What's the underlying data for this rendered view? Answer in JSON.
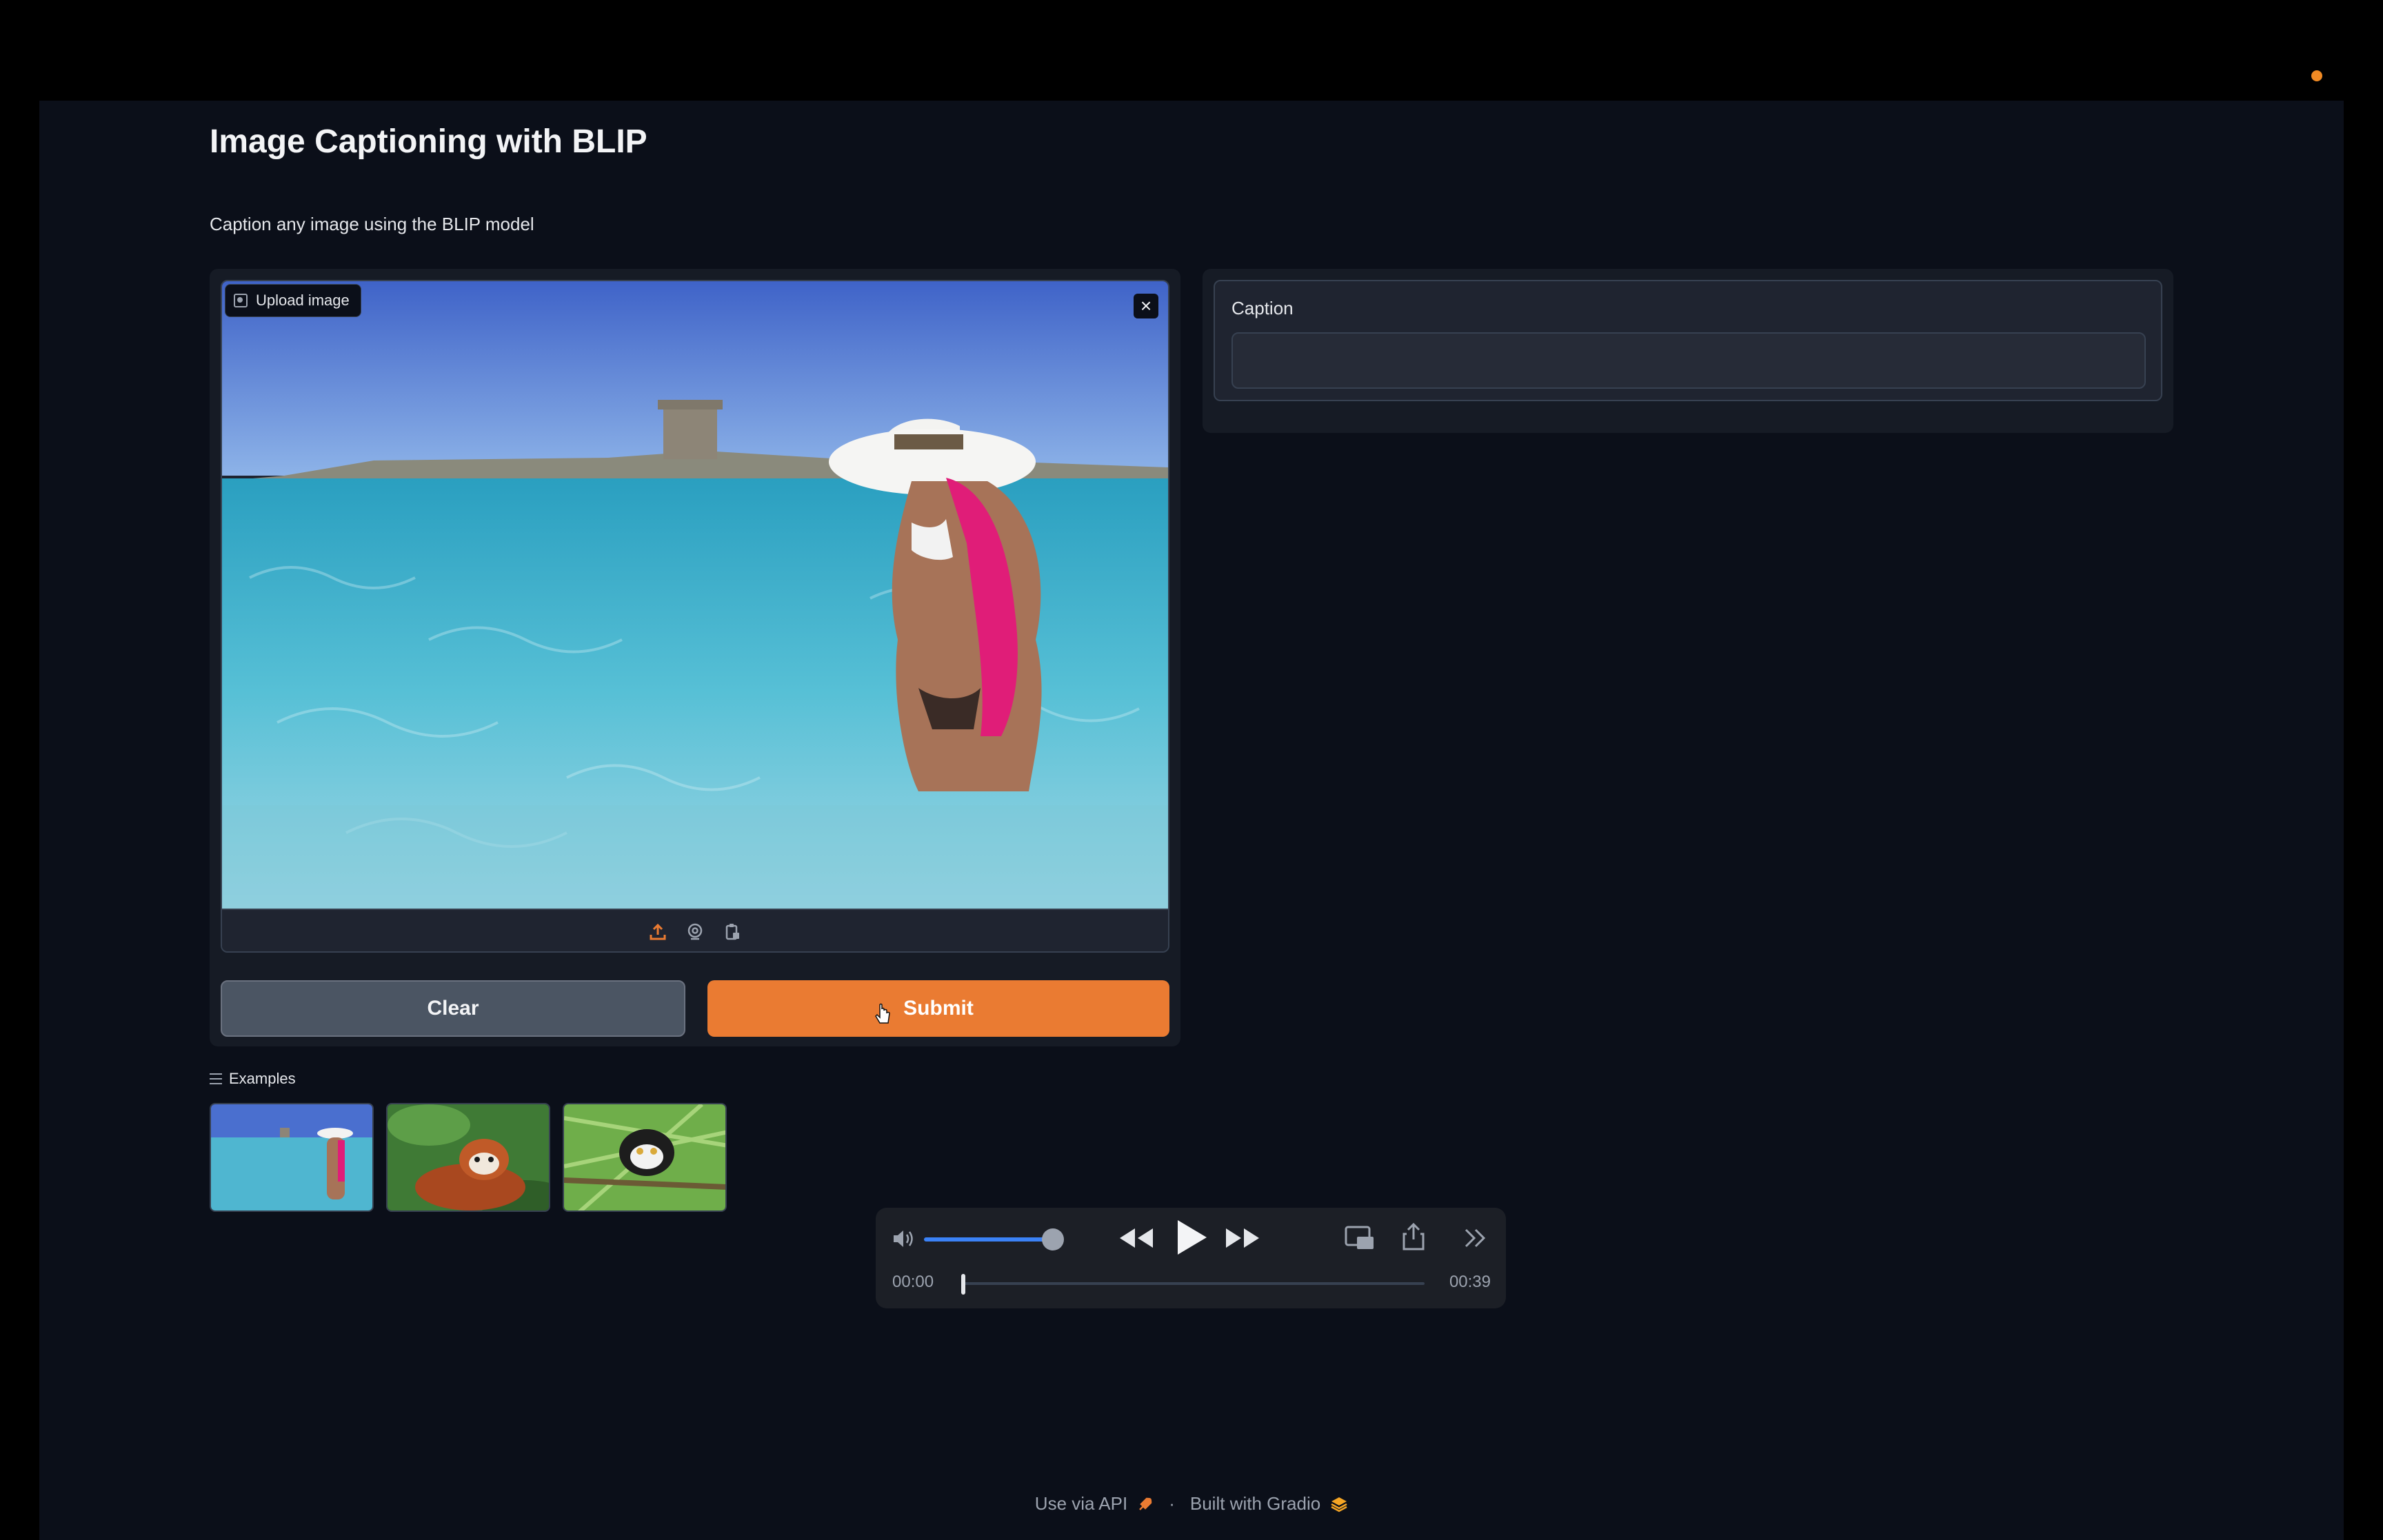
{
  "app": {
    "title": "Image Captioning with BLIP",
    "description": "Caption any image using the BLIP model"
  },
  "input": {
    "image_label": "Upload image",
    "close_symbol": "×",
    "source_icons": [
      "upload-icon",
      "webcam-icon",
      "clipboard-icon"
    ],
    "clear_label": "Clear",
    "submit_label": "Submit"
  },
  "output": {
    "caption_label": "Caption",
    "caption_value": ""
  },
  "examples": {
    "label": "Examples",
    "items": [
      "beach-woman-thumbnail",
      "red-panda-thumbnail",
      "lemur-thumbnail"
    ]
  },
  "player": {
    "current_time": "00:00",
    "total_time": "00:39",
    "volume": 0.85,
    "progress": 0.0
  },
  "footer": {
    "api_label": "Use via API",
    "separator": "·",
    "built_label": "Built with Gradio"
  },
  "colors": {
    "accent": "#ea7b32",
    "background": "#0b0f19",
    "panel": "#161b25",
    "volume_track": "#3b82f6"
  }
}
